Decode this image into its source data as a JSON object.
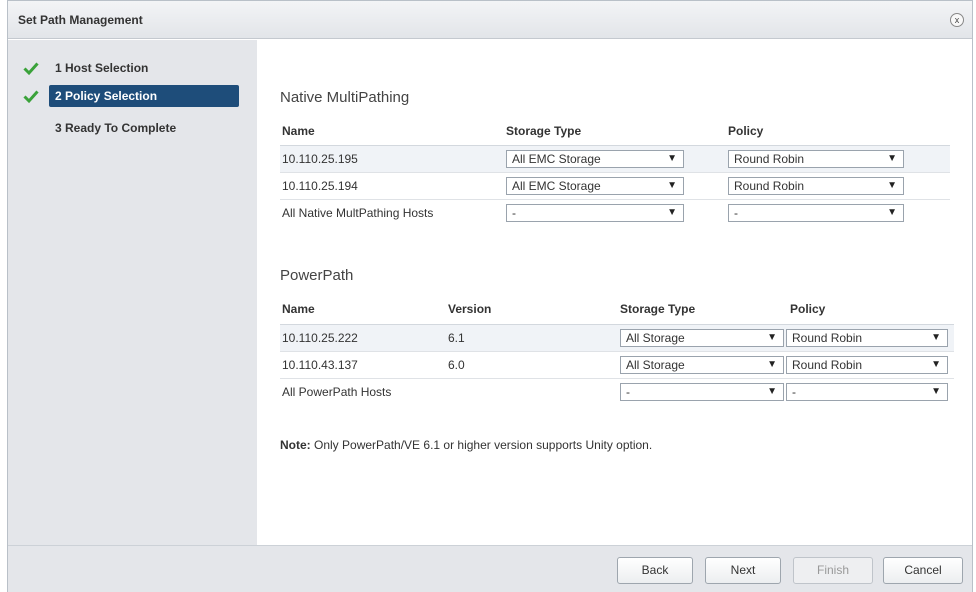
{
  "dialog": {
    "title": "Set Path Management",
    "close_glyph": "x"
  },
  "steps": [
    {
      "label": "1 Host Selection",
      "done": true,
      "active": false
    },
    {
      "label": "2 Policy Selection",
      "done": true,
      "active": true
    },
    {
      "label": "3 Ready To Complete",
      "done": false,
      "active": false
    }
  ],
  "nmp": {
    "title": "Native MultiPathing",
    "headers": {
      "name": "Name",
      "storage_type": "Storage Type",
      "policy": "Policy"
    },
    "rows": [
      {
        "name": "10.110.25.195",
        "storage_type": "All EMC Storage",
        "policy": "Round Robin"
      },
      {
        "name": "10.110.25.194",
        "storage_type": "All EMC Storage",
        "policy": "Round Robin"
      },
      {
        "name": "All Native MultPathing Hosts",
        "storage_type": "-",
        "policy": "-"
      }
    ]
  },
  "powerpath": {
    "title": "PowerPath",
    "headers": {
      "name": "Name",
      "version": "Version",
      "storage_type": "Storage Type",
      "policy": "Policy"
    },
    "rows": [
      {
        "name": "10.110.25.222",
        "version": "6.1",
        "storage_type": "All Storage",
        "policy": "Round Robin"
      },
      {
        "name": "10.110.43.137",
        "version": "6.0",
        "storage_type": "All Storage",
        "policy": "Round Robin"
      },
      {
        "name": "All PowerPath Hosts",
        "version": "",
        "storage_type": "-",
        "policy": "-"
      }
    ]
  },
  "note": {
    "prefix": "Note:",
    "text": " Only PowerPath/VE 6.1 or higher version supports Unity option."
  },
  "footer": {
    "back": "Back",
    "next": "Next",
    "finish": "Finish",
    "cancel": "Cancel"
  },
  "icons": {
    "check": "checkmark-icon",
    "dropdown": "dropdown-arrow-icon",
    "dropdown_glyph": "▼"
  },
  "colors": {
    "active_step": "#1e4d7a",
    "check": "#3aa23a"
  }
}
